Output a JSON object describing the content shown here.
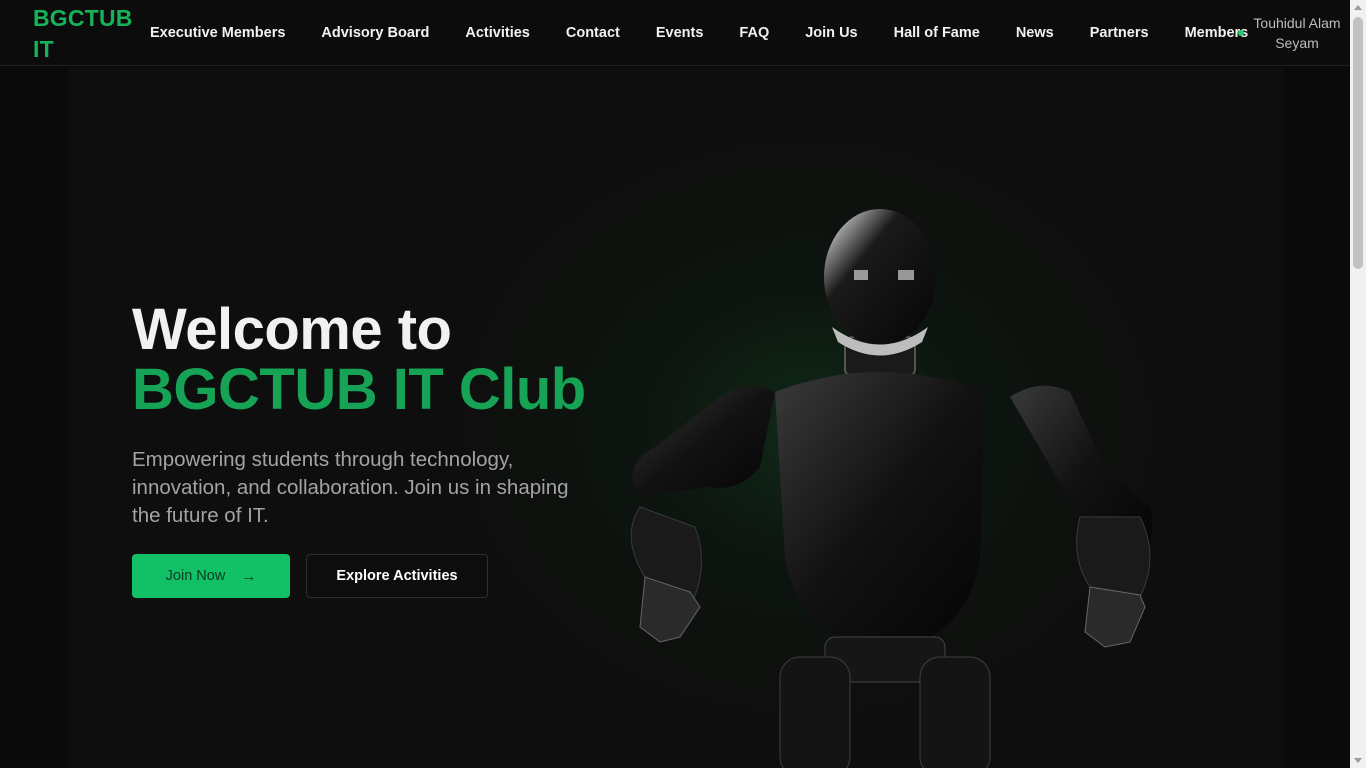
{
  "navbar": {
    "brand": "BGCTUB IT",
    "links": [
      "Executive Members",
      "Advisory Board",
      "Activities",
      "Contact",
      "Events",
      "FAQ",
      "Join Us",
      "Hall of Fame",
      "News",
      "Partners",
      "Members"
    ],
    "user_name": "Touhidul Alam Seyam",
    "online_color": "#1fce6b"
  },
  "hero": {
    "title_line1": "Welcome to",
    "title_line2": "BGCTUB IT Club",
    "description": "Empowering students through technology, innovation, and collaboration. Join us in shaping the future of IT.",
    "join_button": "Join Now",
    "join_icon": "arrow-right-icon",
    "explore_button": "Explore Activities",
    "image": "humanoid-robot"
  },
  "colors": {
    "accent": "#16a355",
    "button": "#12c065",
    "background": "#0a0a0a"
  }
}
